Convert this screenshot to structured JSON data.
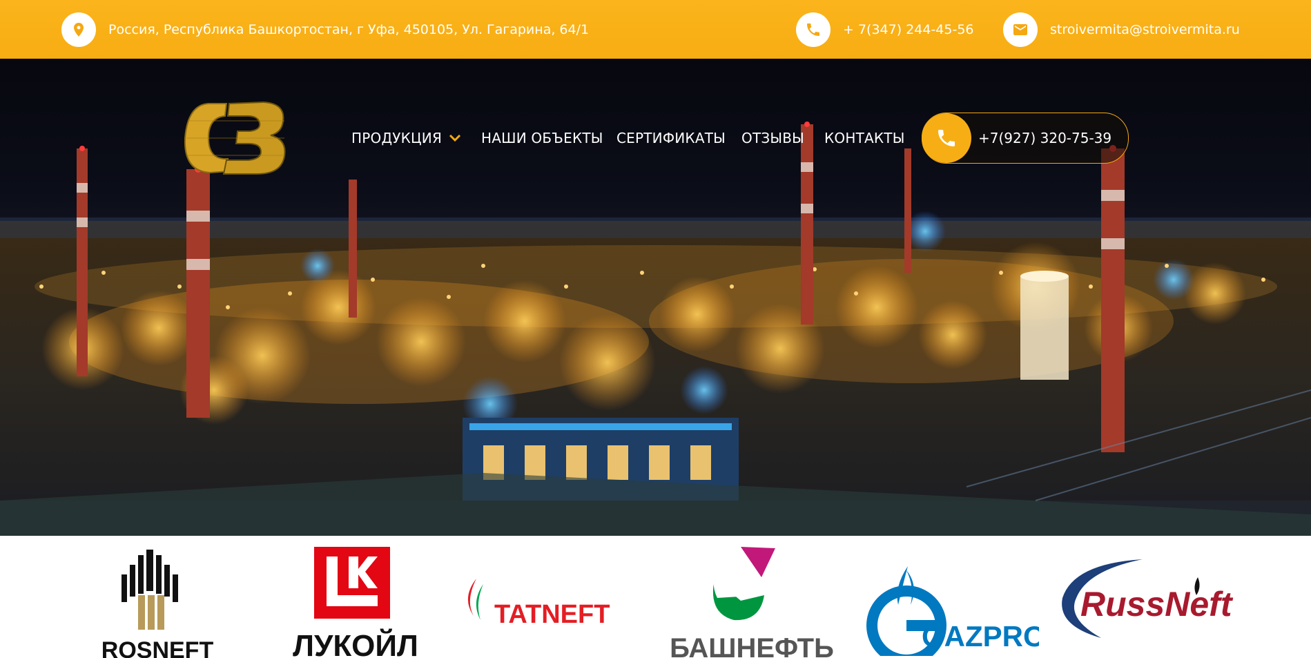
{
  "topbar": {
    "address": "Россия, Республика Башкортостан, г Уфа, 450105, Ул. Гагарина, 64/1",
    "phone": "+ 7(347) 244-45-56",
    "email": "stroivermita@stroivermita.ru"
  },
  "nav": {
    "items": [
      {
        "label": "ПРОДУКЦИЯ"
      },
      {
        "label": "НАШИ ОБЪЕКТЫ"
      },
      {
        "label": "СЕРТИФИКАТЫ"
      },
      {
        "label": "ОТЗЫВЫ"
      },
      {
        "label": "КОНТАКТЫ"
      }
    ],
    "call_number": "+7(927) 320-75-39"
  },
  "partners": {
    "logos": [
      {
        "name": "ROSNEFT"
      },
      {
        "name": "ЛУКОЙЛ"
      },
      {
        "name": "TATNEFT"
      },
      {
        "name": "БАШНЕФТЬ"
      },
      {
        "name": "GAZPROM"
      },
      {
        "name": "RussNeft"
      }
    ]
  },
  "colors": {
    "accent": "#f7ae15",
    "topbar": "#fbb41c",
    "text_light": "#ffffff"
  },
  "icons": {
    "address": "map-pin-icon",
    "phone": "phone-icon",
    "email": "mail-icon",
    "dropdown": "chevron-down-icon"
  }
}
